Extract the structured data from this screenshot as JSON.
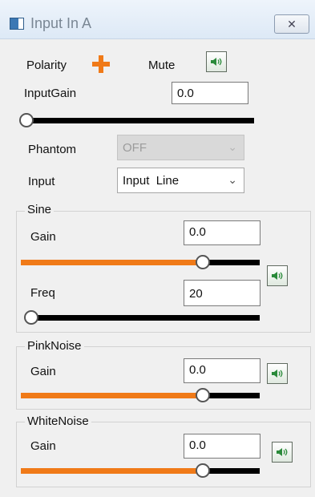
{
  "window": {
    "title": "Input In A",
    "close_glyph": "✕"
  },
  "top": {
    "polarity_label": "Polarity",
    "mute_label": "Mute",
    "input_gain_label": "InputGain",
    "input_gain_value": "0.0",
    "input_gain_level": 0.0
  },
  "phantom": {
    "label": "Phantom",
    "value": "OFF"
  },
  "input": {
    "label": "Input",
    "value": "Input  Line"
  },
  "sine": {
    "title": "Sine",
    "gain_label": "Gain",
    "gain_value": "0.0",
    "gain_level": 0.78,
    "freq_label": "Freq",
    "freq_value": "20",
    "freq_level": 0.0
  },
  "pink_noise": {
    "title": "PinkNoise",
    "gain_label": "Gain",
    "gain_value": "0.0",
    "gain_level": 0.78
  },
  "white_noise": {
    "title": "WhiteNoise",
    "gain_label": "Gain",
    "gain_value": "0.0",
    "gain_level": 0.78
  },
  "colors": {
    "accent": "#f07a18",
    "track": "#000000",
    "speaker": "#2a8a3a"
  },
  "icons": {
    "polarity": "plus-icon",
    "mute": "speaker-icon",
    "chevron": "chevron-down-icon",
    "window": "window-icon"
  }
}
